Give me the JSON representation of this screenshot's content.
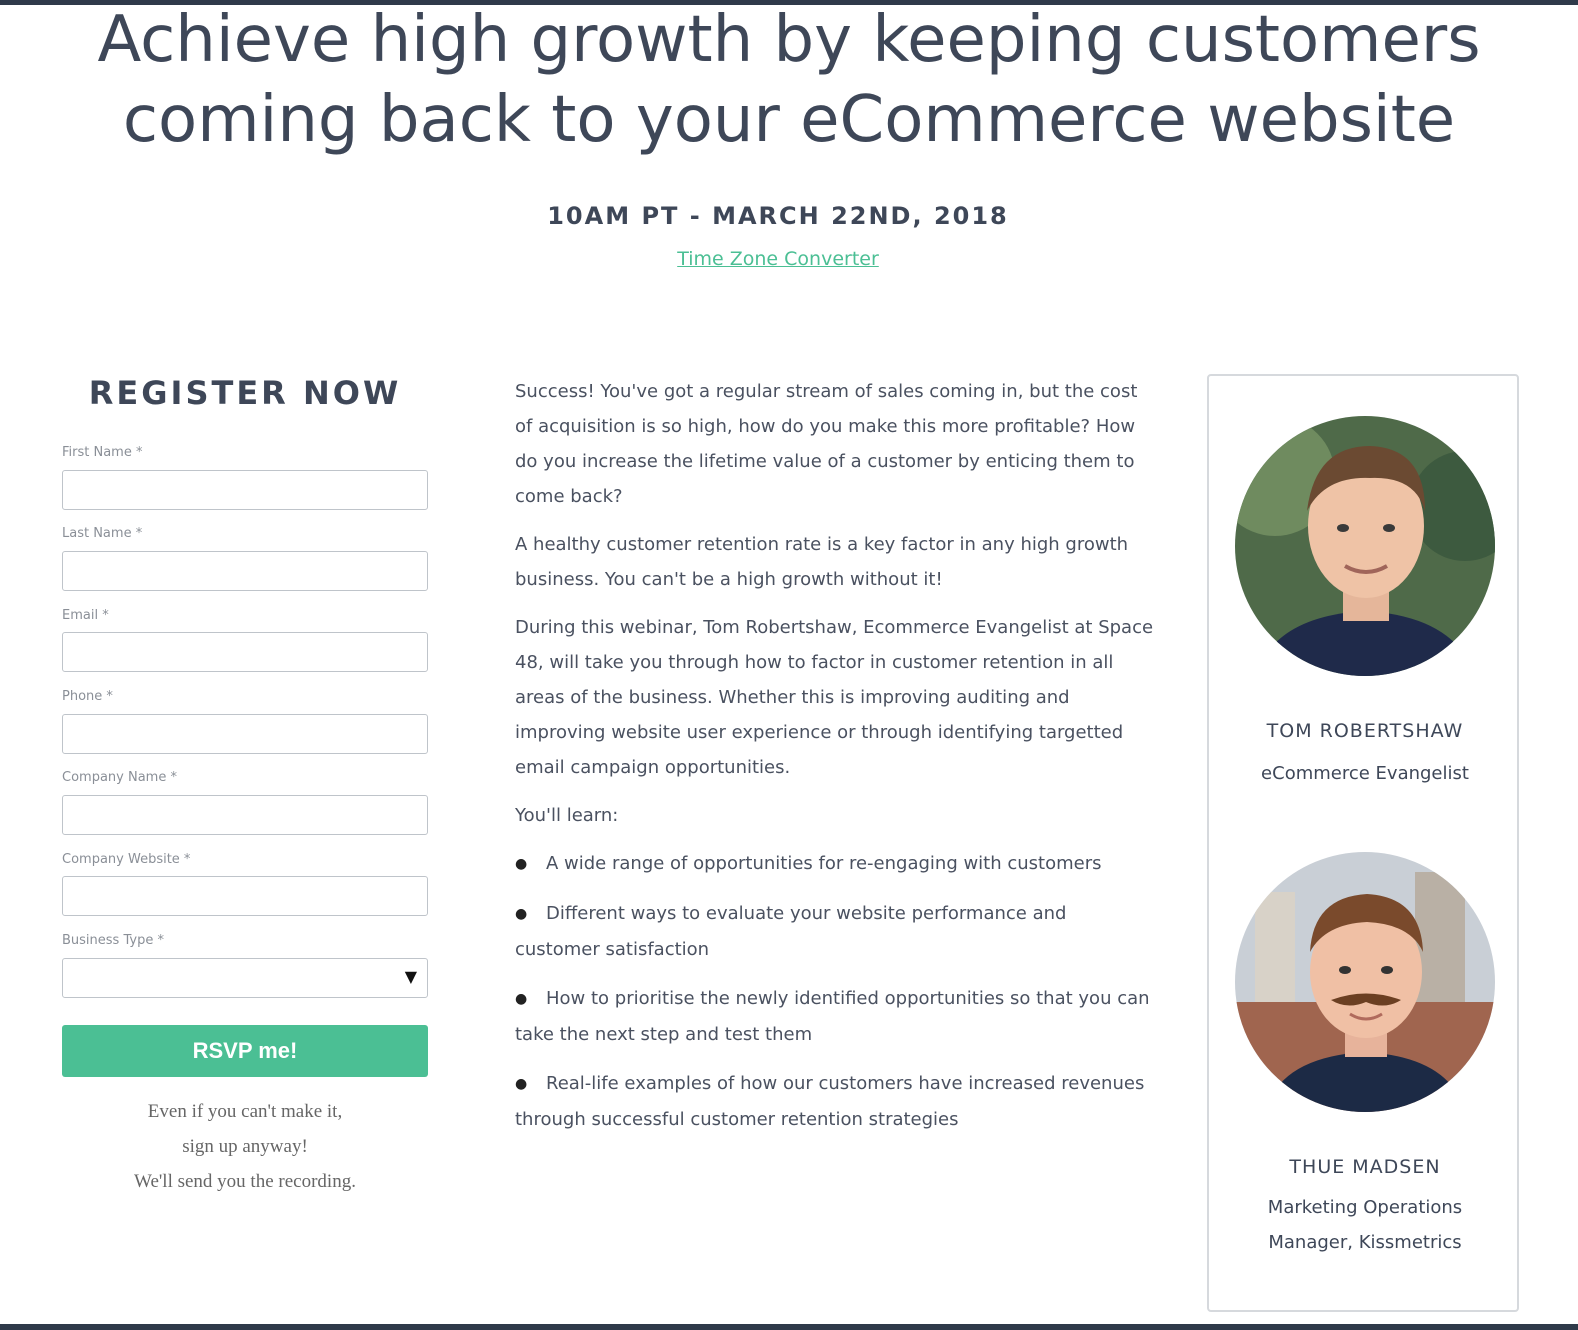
{
  "headline": {
    "line1": "Achieve high growth by keeping customers",
    "line2": "coming back to your eCommerce website"
  },
  "event": {
    "date_time": "10AM PT - MARCH 22ND, 2018",
    "tz_link": "Time Zone Converter"
  },
  "register": {
    "title": "REGISTER NOW",
    "fields": [
      {
        "label": "First Name *",
        "value": ""
      },
      {
        "label": "Last Name *",
        "value": ""
      },
      {
        "label": "Email *",
        "value": ""
      },
      {
        "label": "Phone *",
        "value": ""
      },
      {
        "label": "Company Name *",
        "value": ""
      },
      {
        "label": "Company Website *",
        "value": ""
      }
    ],
    "business_type": {
      "label": "Business Type *",
      "selected": ""
    },
    "submit_label": "RSVP me!",
    "fine_print": [
      "Even if you can't make it,",
      "sign up anyway!",
      "We'll send you the recording."
    ]
  },
  "description": {
    "paragraphs": [
      "Success! You've got a regular stream of sales coming in, but the cost of acquisition is so high, how do you make this more profitable? How do you increase the lifetime value of a customer by enticing them to come back?",
      "A healthy customer retention rate is a key factor in any high growth business. You can't be a high growth without it!",
      "During this webinar, Tom Robertshaw, Ecommerce Evangelist at Space 48, will take you through how to factor in customer retention in all areas of the business. Whether this is improving auditing and improving website user experience or through identifying targetted email campaign opportunities.",
      "You'll learn:"
    ],
    "bullets": [
      "A wide range of opportunities for re-engaging with customers",
      "Different ways to evaluate your website performance and customer satisfaction",
      "How to prioritise the newly identified opportunities so that you can take the next step and test them",
      "Real-life examples of how our customers have increased revenues through successful customer retention strategies"
    ],
    "bullet_glyph": "●"
  },
  "speakers": [
    {
      "name": "TOM ROBERTSHAW",
      "role": "eCommerce Evangelist"
    },
    {
      "name": "THUE MADSEN",
      "role": "Marketing Operations Manager, Kissmetrics"
    }
  ],
  "colors": {
    "accent": "#4bbf94",
    "heading": "#3e4758",
    "dark_bar": "#2f3a4a"
  }
}
